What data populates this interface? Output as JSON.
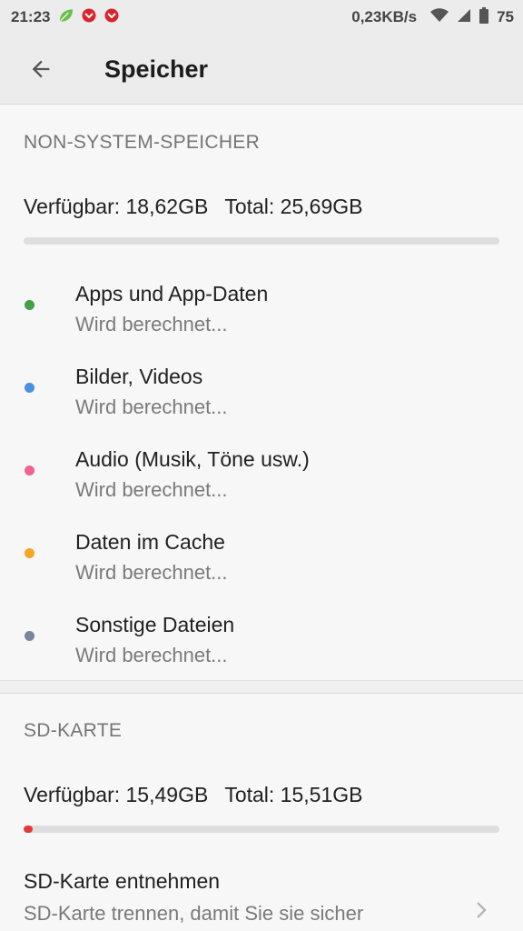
{
  "status_bar": {
    "time": "21:23",
    "network_speed": "0,23KB/s",
    "battery": "75",
    "icons": [
      "leaf-icon",
      "notification-icon",
      "notification-icon",
      "wifi-icon",
      "signal-icon",
      "battery-icon"
    ]
  },
  "app_bar": {
    "back_icon": "arrow-back-icon",
    "title": "Speicher"
  },
  "internal_storage": {
    "header": "NON-SYSTEM-SPEICHER",
    "available": "Verfügbar: 18,62GB",
    "total": "Total: 25,69GB",
    "usage_fraction": 0.0,
    "categories": [
      {
        "label": "Apps und App-Daten",
        "status": "Wird berechnet...",
        "color": "#43a047"
      },
      {
        "label": "Bilder, Videos",
        "status": "Wird berechnet...",
        "color": "#4a90e2"
      },
      {
        "label": "Audio (Musik, Töne usw.)",
        "status": "Wird berechnet...",
        "color": "#f06292"
      },
      {
        "label": "Daten im Cache",
        "status": "Wird berechnet...",
        "color": "#f5a623"
      },
      {
        "label": "Sonstige Dateien",
        "status": "Wird berechnet...",
        "color": "#7a869a"
      }
    ]
  },
  "sd_card": {
    "header": "SD-KARTE",
    "available": "Verfügbar: 15,49GB",
    "total": "Total: 15,51GB",
    "usage_fraction": 0.02,
    "usage_color": "#e53935",
    "eject": {
      "title": "SD-Karte entnehmen",
      "subtitle": "SD-Karte trennen, damit Sie sie sicher",
      "icon": "chevron-right-icon"
    }
  }
}
